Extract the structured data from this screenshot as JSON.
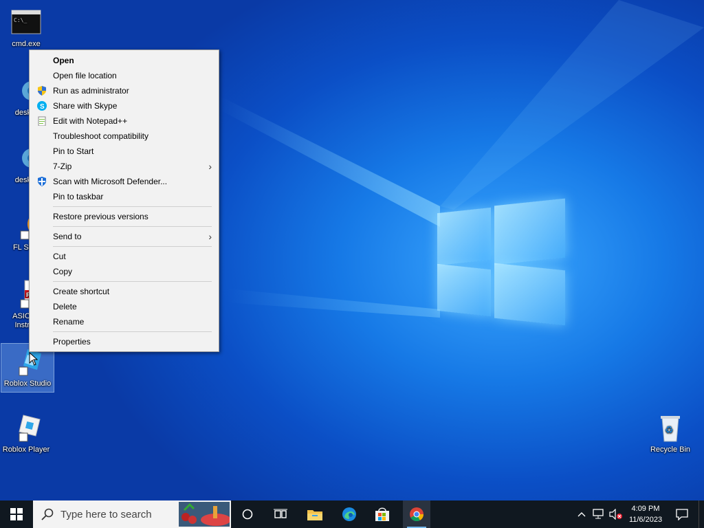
{
  "desktop": {
    "icons": [
      {
        "label": "cmd.exe"
      },
      {
        "label": "deskto"
      },
      {
        "label": "deskto"
      },
      {
        "label": "FL Stud"
      },
      {
        "label": "ASIO4A"
      },
      {
        "label": "Instruc"
      },
      {
        "label": "Roblox Studio"
      },
      {
        "label": "Roblox Player"
      },
      {
        "label": "Recycle Bin"
      }
    ]
  },
  "context_menu": {
    "items": [
      {
        "label": "Open"
      },
      {
        "label": "Open file location"
      },
      {
        "label": "Run as administrator",
        "icon": "uac-shield-icon"
      },
      {
        "label": "Share with Skype",
        "icon": "skype-icon"
      },
      {
        "label": "Edit with Notepad++",
        "icon": "notepadpp-icon"
      },
      {
        "label": "Troubleshoot compatibility"
      },
      {
        "label": "Pin to Start"
      },
      {
        "label": "7-Zip",
        "submenu": true
      },
      {
        "label": "Scan with Microsoft Defender...",
        "icon": "defender-shield-icon"
      },
      {
        "label": "Pin to taskbar"
      },
      {
        "label": "Restore previous versions"
      },
      {
        "label": "Send to",
        "submenu": true
      },
      {
        "label": "Cut"
      },
      {
        "label": "Copy"
      },
      {
        "label": "Create shortcut"
      },
      {
        "label": "Delete"
      },
      {
        "label": "Rename"
      },
      {
        "label": "Properties"
      }
    ]
  },
  "taskbar": {
    "search_placeholder": "Type here to search",
    "pinned": [
      "cortana-circle-icon",
      "task-view-icon",
      "file-explorer-icon",
      "edge-icon",
      "microsoft-store-icon",
      "chrome-icon"
    ],
    "clock": {
      "time": "4:09 PM",
      "date": "11/6/2023"
    }
  },
  "colors": {
    "taskbar": "#101820",
    "menu_bg": "#f2f2f2",
    "accent": "#76b9ed"
  }
}
